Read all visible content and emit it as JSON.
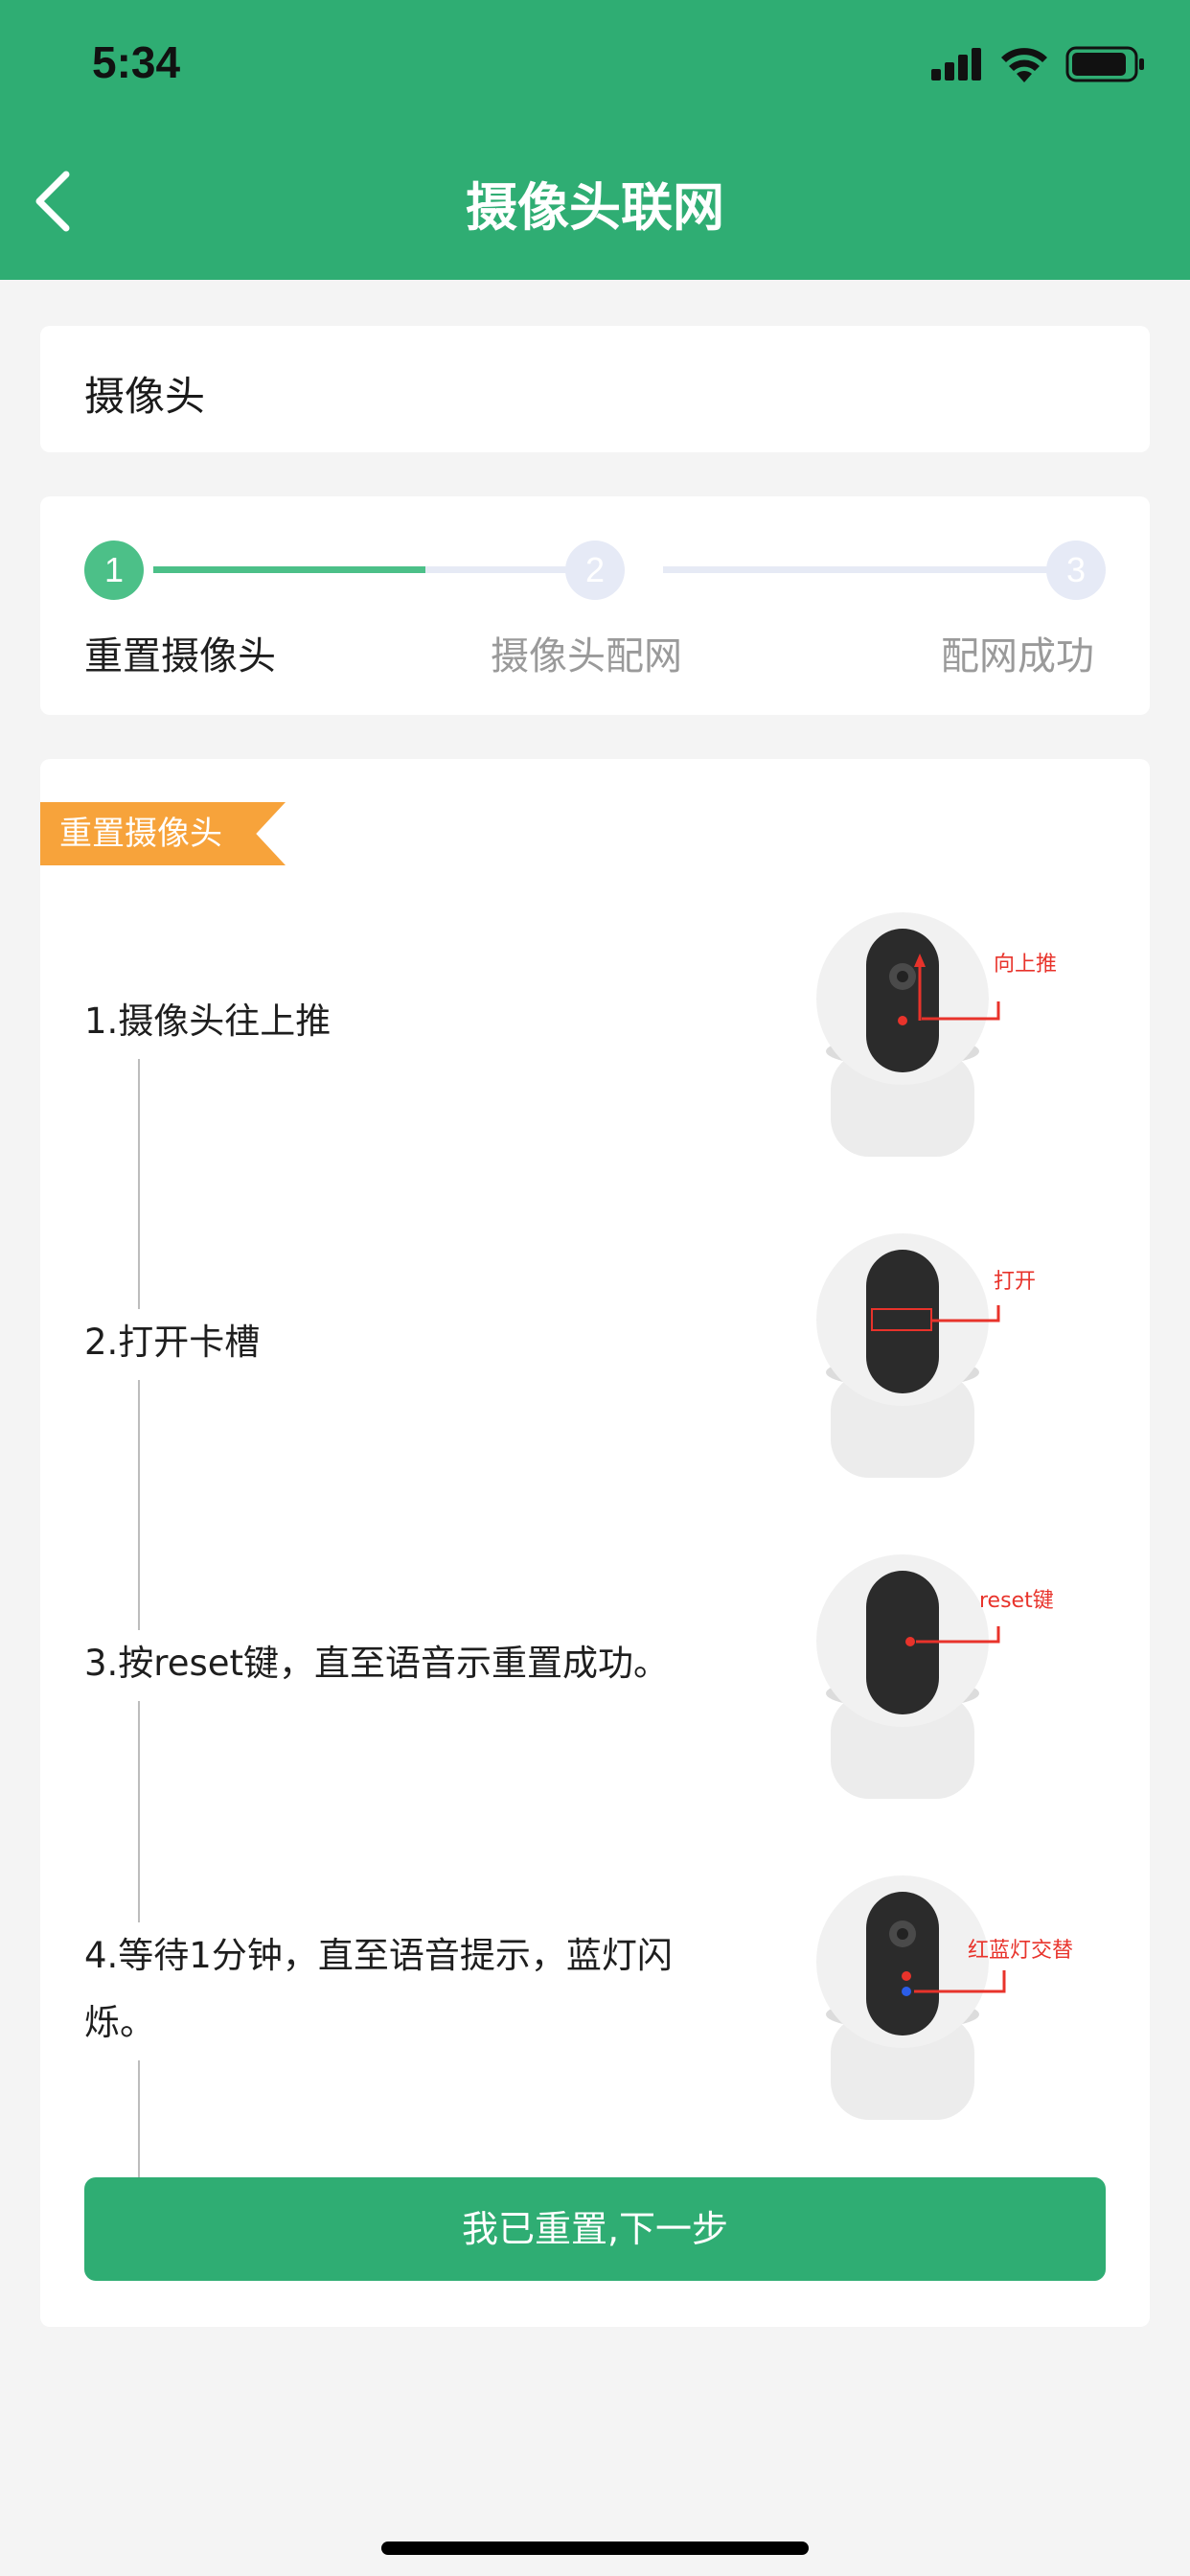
{
  "status_bar": {
    "time": "5:34"
  },
  "nav": {
    "title": "摄像头联网"
  },
  "device": {
    "name": "摄像头"
  },
  "stepper": {
    "steps": [
      {
        "number": "1",
        "label": "重置摄像头"
      },
      {
        "number": "2",
        "label": "摄像头配网"
      },
      {
        "number": "3",
        "label": "配网成功"
      }
    ],
    "current_step": 1
  },
  "guide": {
    "ribbon": "重置摄像头",
    "steps": [
      {
        "text": "1.摄像头往上推",
        "annotation": "向上推"
      },
      {
        "text": "2.打开卡槽",
        "annotation": "打开"
      },
      {
        "text": "3.按reset键，直至语音示重置成功。",
        "annotation": "reset键"
      },
      {
        "text": "4.等待1分钟，直至语音提示，蓝灯闪烁。",
        "annotation": "红蓝灯交替"
      }
    ],
    "next_button": "我已重置,下一步"
  },
  "colors": {
    "brand_green": "#2fad73",
    "step_active": "#4cc088",
    "step_inactive": "#e6eaf6",
    "ribbon_orange": "#f7a33b",
    "annotation_red": "#e8332b"
  }
}
